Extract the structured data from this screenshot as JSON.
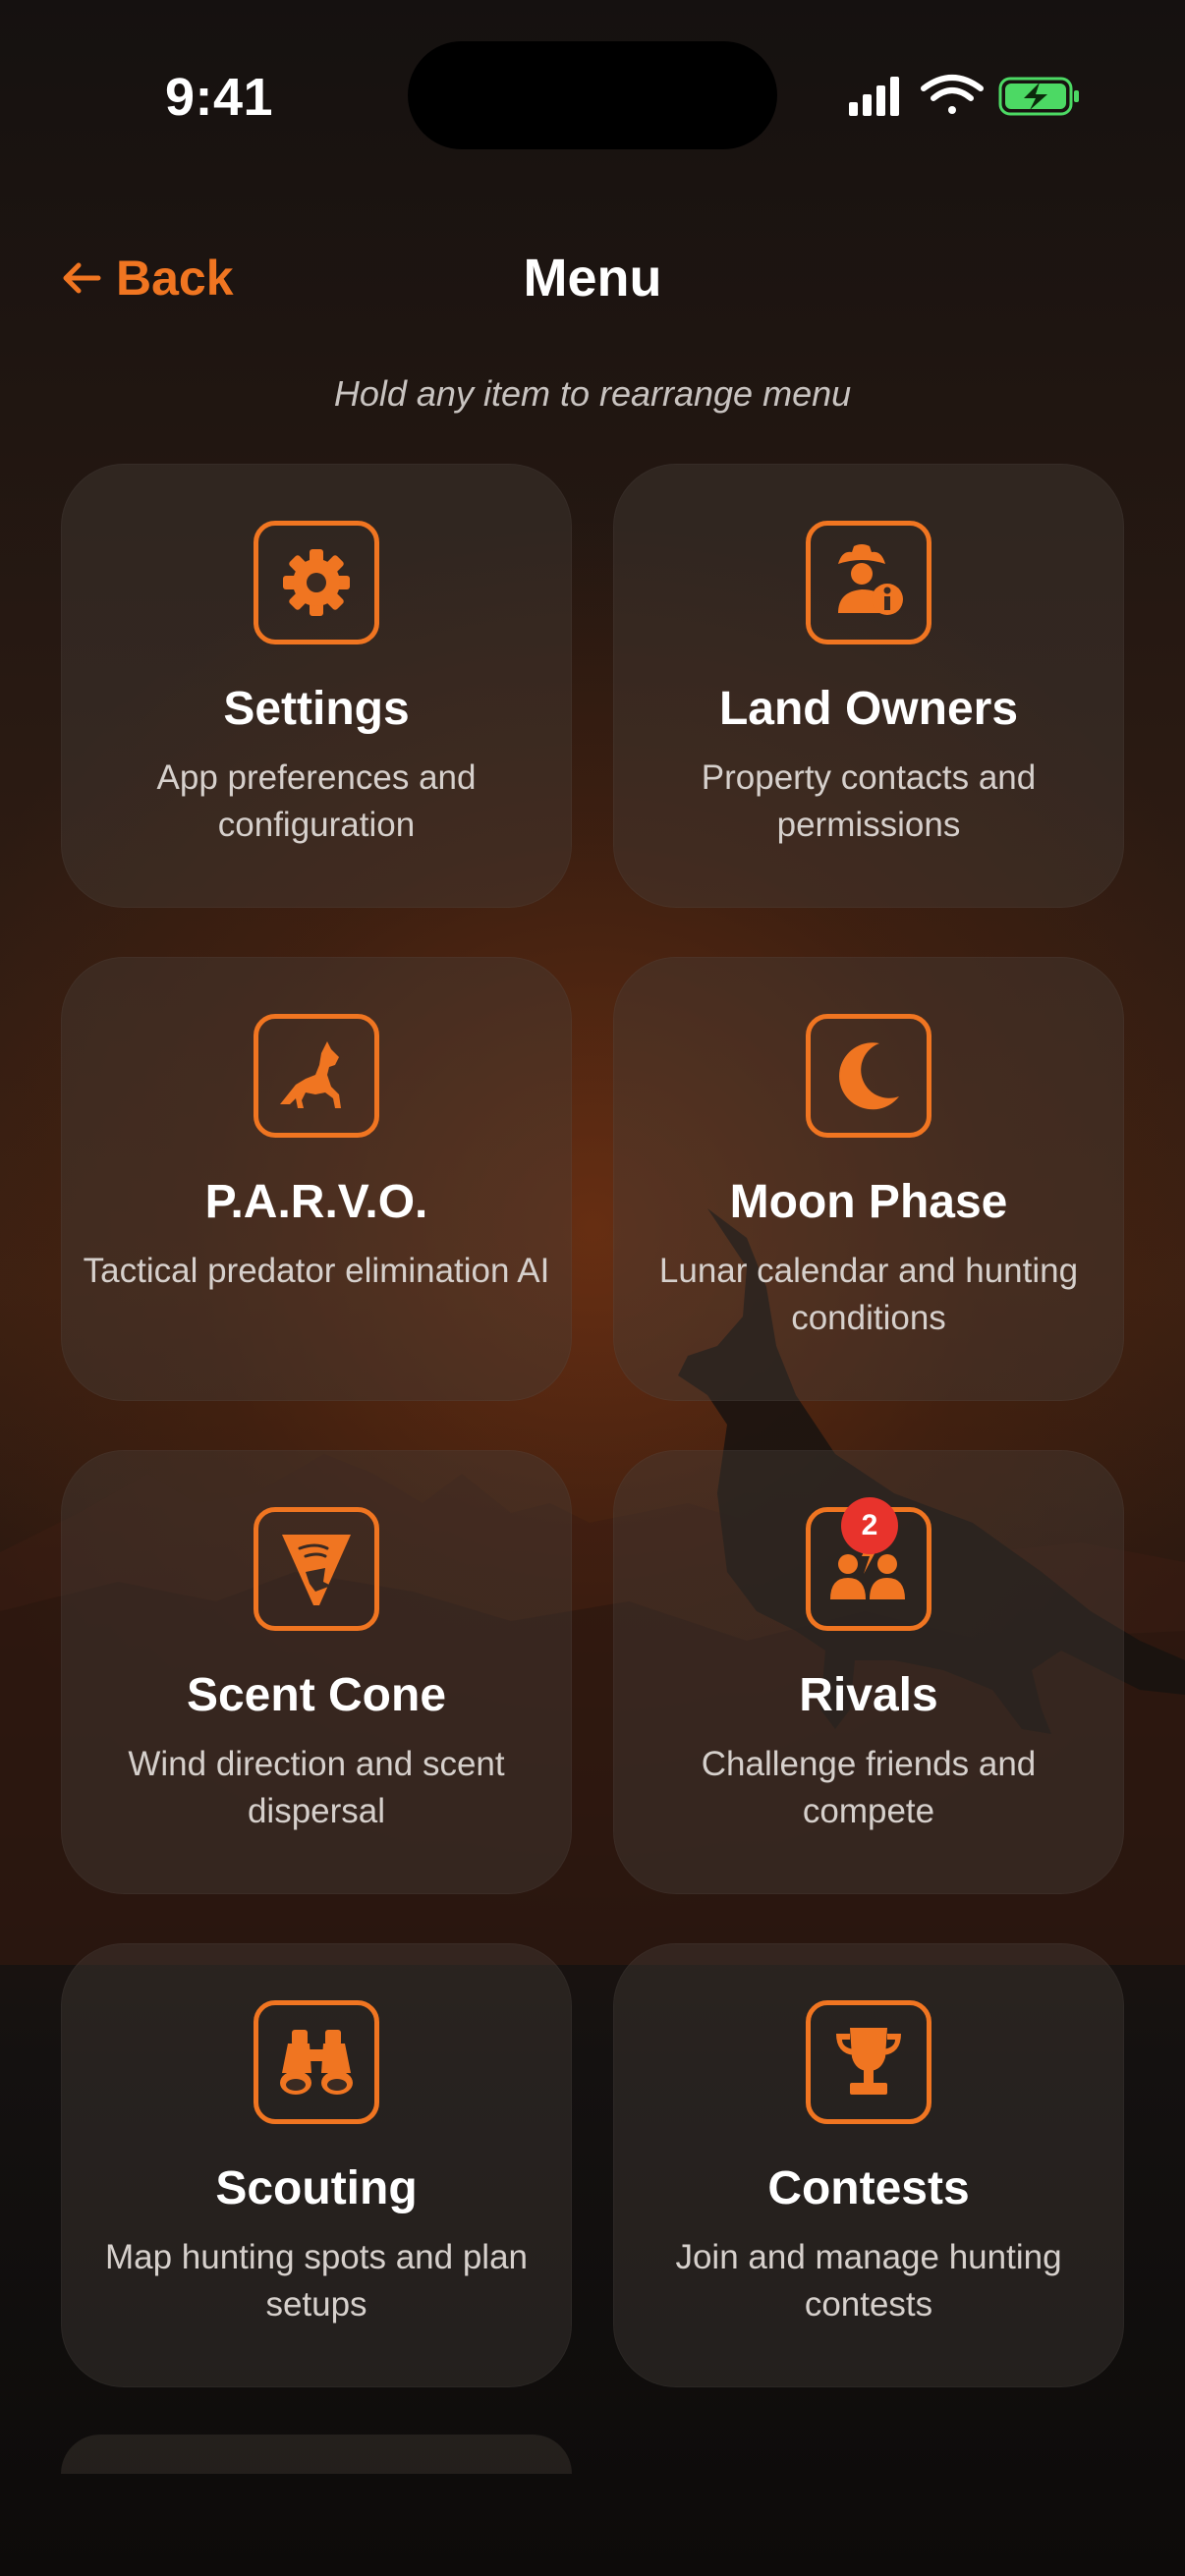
{
  "status_bar": {
    "time": "9:41"
  },
  "nav": {
    "back_label": "Back",
    "title": "Menu"
  },
  "hint": "Hold any item to rearrange menu",
  "accent_color": "#f07521",
  "badge_color": "#e8332c",
  "menu_items": [
    {
      "title": "Settings",
      "description": "App preferences and configuration",
      "icon": "gear-icon"
    },
    {
      "title": "Land Owners",
      "description": "Property contacts and permissions",
      "icon": "landowner-icon"
    },
    {
      "title": "P.A.R.V.O.",
      "description": "Tactical predator elimination AI",
      "icon": "howling-wolf-icon"
    },
    {
      "title": "Moon Phase",
      "description": "Lunar calendar and hunting conditions",
      "icon": "crescent-moon-icon"
    },
    {
      "title": "Scent Cone",
      "description": "Wind direction and scent dispersal",
      "icon": "scent-cone-icon"
    },
    {
      "title": "Rivals",
      "description": "Challenge friends and compete",
      "icon": "rivals-icon",
      "badge": "2"
    },
    {
      "title": "Scouting",
      "description": "Map hunting spots and plan setups",
      "icon": "binoculars-icon"
    },
    {
      "title": "Contests",
      "description": "Join and manage hunting contests",
      "icon": "trophy-icon"
    }
  ]
}
